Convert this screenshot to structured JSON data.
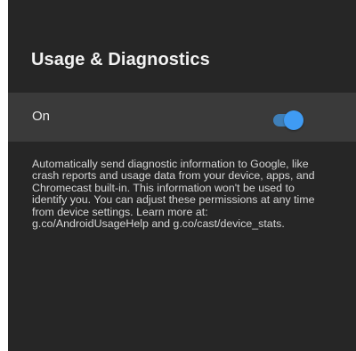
{
  "screen": {
    "title": "Usage & Diagnostics"
  },
  "setting": {
    "label": "On",
    "toggle_state": true,
    "accent_color": "#3f9bf4"
  },
  "description": "Automatically send diagnostic information to Google, like crash reports and usage data from your device, apps, and Chromecast built-in. This information won't be used to identify you. You can adjust these permissions at any time from device settings. Learn more at: g.co/AndroidUsageHelp and g.co/cast/device_stats."
}
